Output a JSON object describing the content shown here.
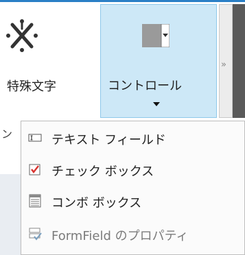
{
  "ribbon": {
    "special_chars": {
      "label": "特殊文字",
      "icon": "asterisk-icon"
    },
    "control": {
      "label": "コントロール",
      "icon": "dropdown-control-icon"
    },
    "scroll_glyph": "»"
  },
  "background": {
    "partial_text": "ン"
  },
  "menu": {
    "items": [
      {
        "label": "テキスト フィールド",
        "icon": "text-field-icon"
      },
      {
        "label": "チェック ボックス",
        "icon": "checkbox-icon"
      },
      {
        "label": "コンボ ボックス",
        "icon": "combo-box-icon"
      },
      {
        "label": "FormField のプロパティ",
        "icon": "formfield-properties-icon",
        "disabled": true
      }
    ]
  },
  "colors": {
    "accent": "#2b7fc6",
    "control_highlight": "#cde8f7",
    "check_red": "#d9332f"
  }
}
